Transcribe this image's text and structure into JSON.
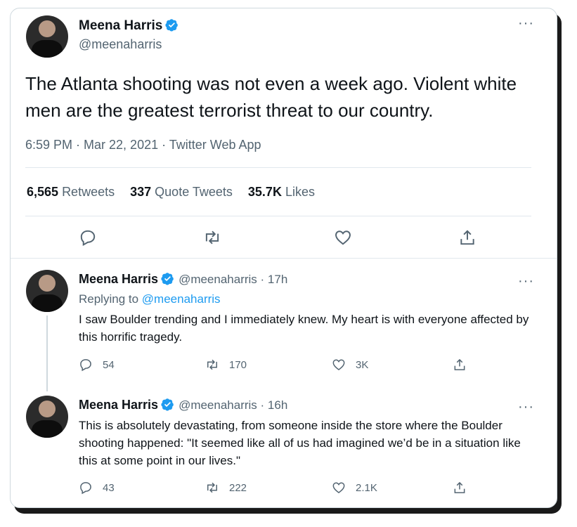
{
  "main_tweet": {
    "author_name": "Meena Harris",
    "handle": "@meenaharris",
    "text": "The Atlanta shooting was not even a week ago. Violent white men are the greatest terrorist threat to our country.",
    "meta": "6:59 PM · Mar 22, 2021 · Twitter Web App",
    "stats": {
      "retweets_count": "6,565",
      "retweets_label": "Retweets",
      "quotes_count": "337",
      "quotes_label": "Quote Tweets",
      "likes_count": "35.7K",
      "likes_label": "Likes"
    },
    "actions": [
      "reply-icon",
      "retweet-icon",
      "like-icon",
      "share-icon"
    ]
  },
  "replies": [
    {
      "author_name": "Meena Harris",
      "handle_time": "@meenaharris · 17h",
      "replying_prefix": "Replying to",
      "replying_to": "@meenaharris",
      "text": "I saw Boulder trending and I immediately knew. My heart is with everyone affected by this horrific tragedy.",
      "reply_count": "54",
      "retweet_count": "170",
      "like_count": "3K"
    },
    {
      "author_name": "Meena Harris",
      "handle_time": "@meenaharris · 16h",
      "text": "This is absolutely devastating, from someone inside the store where the Boulder shooting happened: \"It seemed like all of us had imagined we’d be in a situation like this at some point in our lives.\"",
      "reply_count": "43",
      "retweet_count": "222",
      "like_count": "2.1K"
    }
  ],
  "colors": {
    "verified": "#1d9bf0",
    "muted_text": "#536471",
    "primary_text": "#0f1419",
    "divider": "#e1e8ed"
  },
  "more_label": "···"
}
